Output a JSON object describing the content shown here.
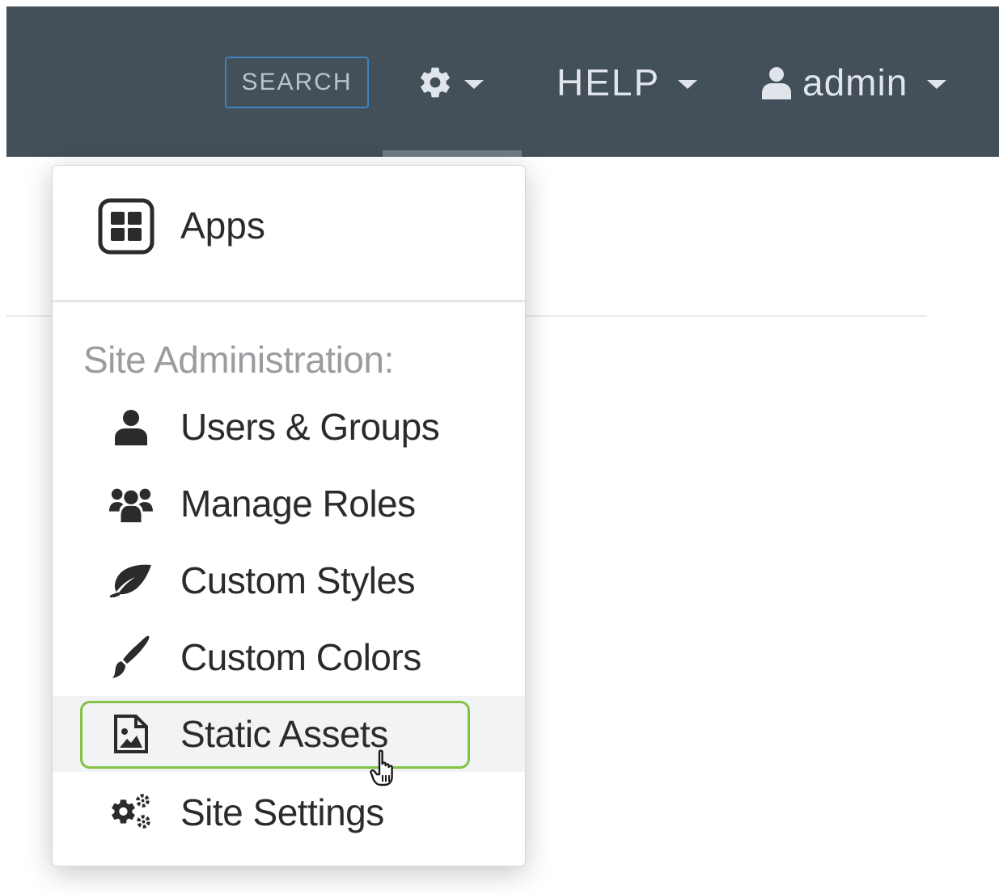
{
  "navbar": {
    "search_label": "SEARCH",
    "settings_icon": "gear-icon",
    "help_label": "HELP",
    "user_label": "admin",
    "background": "#434f59"
  },
  "dropdown": {
    "apps": {
      "label": "Apps",
      "icon": "grid-icon"
    },
    "section_header": "Site Administration:",
    "items": [
      {
        "label": "Users & Groups",
        "icon": "user-icon"
      },
      {
        "label": "Manage Roles",
        "icon": "users-icon"
      },
      {
        "label": "Custom Styles",
        "icon": "leaf-icon"
      },
      {
        "label": "Custom Colors",
        "icon": "paintbrush-icon"
      },
      {
        "label": "Static Assets",
        "icon": "image-file-icon"
      },
      {
        "label": "Site Settings",
        "icon": "cogs-icon"
      }
    ],
    "highlight_color": "#82c244"
  }
}
